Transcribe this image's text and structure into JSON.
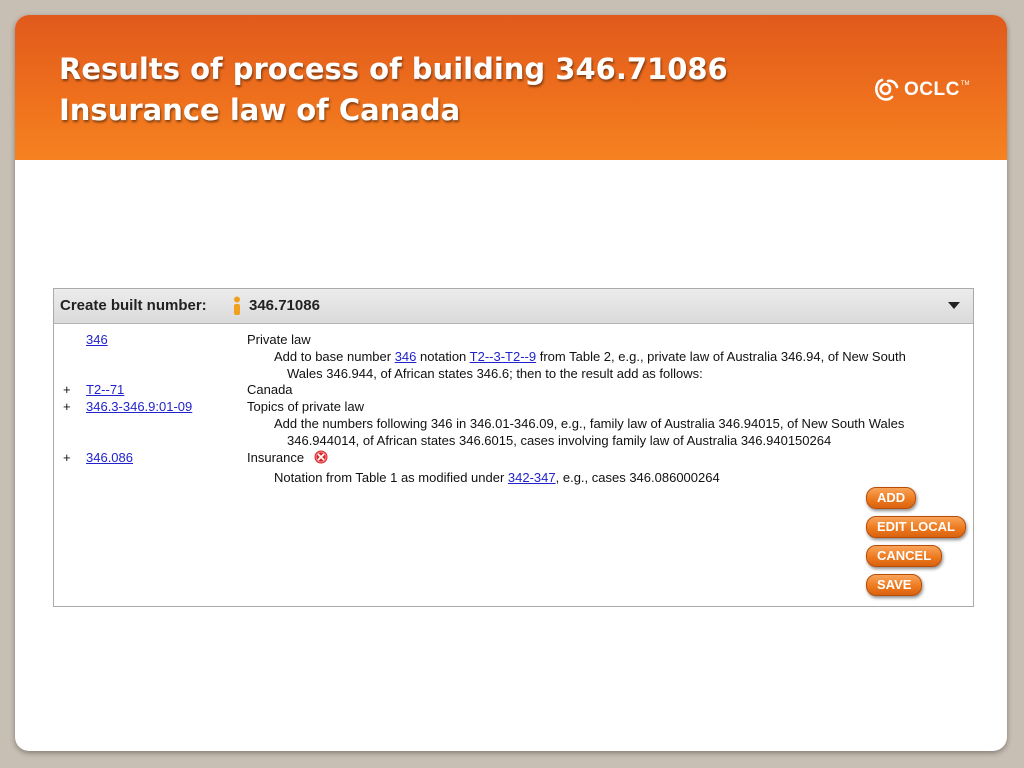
{
  "slide": {
    "title_line1": "Results of process of building 346.71086",
    "title_line2": "Insurance law of Canada",
    "logo_text": "OCLC",
    "logo_tm": "TM"
  },
  "panel": {
    "title": "Create built number:",
    "built_number": "346.71086",
    "rows": [
      {
        "pm": "",
        "code": "346",
        "label": "Private law",
        "note_a": "Add to base number ",
        "note_link1": "346",
        "note_b": " notation ",
        "note_link2": "T2--3-T2--9",
        "note_c": " from Table 2, e.g., private law of Australia 346.94, of New South",
        "note_line2": "Wales 346.944, of African states 346.6; then to the result add as follows:"
      },
      {
        "pm": "+",
        "code": "T2--71",
        "label": "Canada"
      },
      {
        "pm": "+",
        "code": "346.3-346.9:01-09",
        "label": "Topics of private law",
        "note_line1": "Add the numbers following 346 in 346.01-346.09, e.g., family law of Australia 346.94015, of New South Wales",
        "note_line2": "346.944014, of African states 346.6015, cases involving family law of Australia 346.940150264"
      },
      {
        "pm": "+",
        "code": "346.086",
        "label": "Insurance",
        "note_a": "Notation from Table 1 as modified under ",
        "note_link": "342-347",
        "note_b": ", e.g., cases 346.086000264"
      }
    ],
    "buttons": {
      "add": "ADD",
      "edit_local": "EDIT LOCAL",
      "cancel": "CANCEL",
      "save": "SAVE"
    }
  },
  "colors": {
    "header_orange": "#ee6f1d",
    "button_orange": "#ee7a1f",
    "link_blue": "#2222cc",
    "error_red": "#d9262b"
  },
  "icons": {
    "logo": "oclc-logo-icon",
    "person": "person-icon",
    "dropdown": "chevron-down-icon",
    "error": "error-icon"
  }
}
